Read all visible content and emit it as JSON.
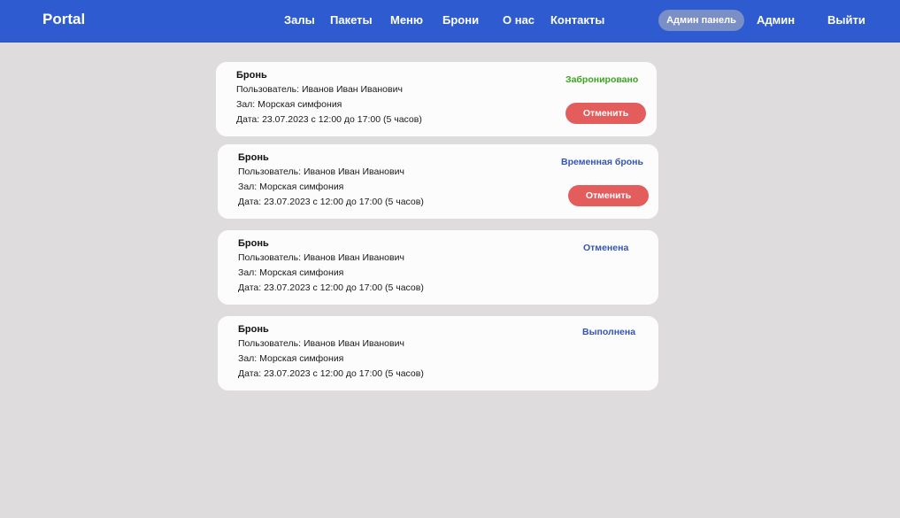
{
  "navbar": {
    "brand": "Portal",
    "links": [
      "Залы",
      "Пакеты",
      "Меню",
      "Брони",
      "О нас",
      "Контакты"
    ],
    "admin_panel": "Админ панель",
    "admin": "Админ",
    "logout": "Выйти"
  },
  "bookings": [
    {
      "title": "Бронь",
      "user": "Пользователь: Иванов Иван Иванович",
      "hall": "Зал: Морская симфония",
      "date": "Дата: 23.07.2023 с 12:00 до 17:00 (5 часов)",
      "status": "Забронировано",
      "status_color": "#3aa51f",
      "cancel_label": "Отменить"
    },
    {
      "title": "Бронь",
      "user": "Пользователь: Иванов Иван Иванович",
      "hall": "Зал: Морская симфония",
      "date": "Дата: 23.07.2023 с 12:00 до 17:00 (5 часов)",
      "status": "Временная бронь",
      "status_color": "#3454b4",
      "cancel_label": "Отменить"
    },
    {
      "title": "Бронь",
      "user": "Пользователь: Иванов Иван Иванович",
      "hall": "Зал: Морская симфония",
      "date": "Дата: 23.07.2023 с 12:00 до 17:00 (5 часов)",
      "status": "Отменена",
      "status_color": "#3454b4"
    },
    {
      "title": "Бронь",
      "user": "Пользователь: Иванов Иван Иванович",
      "hall": "Зал: Морская симфония",
      "date": "Дата: 23.07.2023 с 12:00 до 17:00 (5 часов)",
      "status": "Выполнена",
      "status_color": "#3454b4"
    }
  ],
  "colors": {
    "nav_bg": "#2f5bd0",
    "page_bg": "#dfdcdd",
    "cancel_bg": "#e35d5d"
  }
}
